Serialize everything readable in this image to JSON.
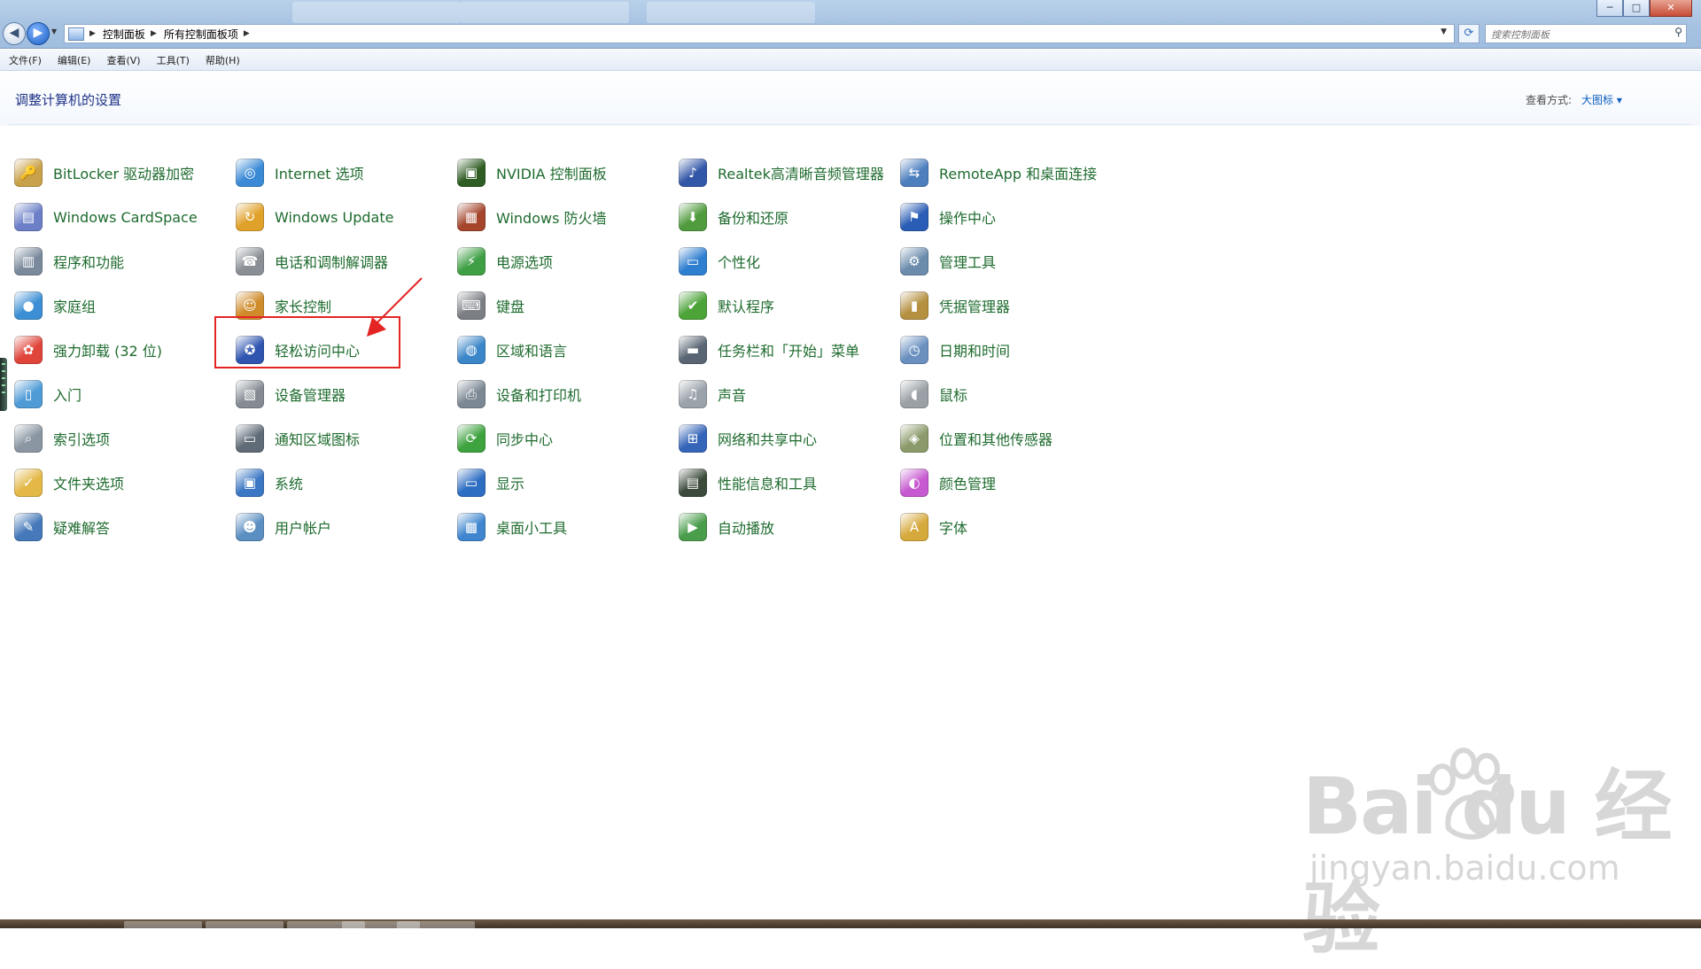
{
  "window": {
    "controls": [
      "─",
      "□",
      "✕"
    ]
  },
  "nav": {
    "back_icon": "back-arrow-icon",
    "forward_icon": "forward-arrow-icon",
    "breadcrumb": [
      "控制面板",
      "所有控制面板项"
    ],
    "search_placeholder": "搜索控制面板"
  },
  "menu": [
    "文件(F)",
    "编辑(E)",
    "查看(V)",
    "工具(T)",
    "帮助(H)"
  ],
  "header": {
    "title": "调整计算机的设置",
    "view_by_label": "查看方式:",
    "view_by_value": "大图标 ▾"
  },
  "items": [
    {
      "label": "BitLocker 驱动器加密",
      "icon": "bitlocker-icon",
      "color": "#c9a14a"
    },
    {
      "label": "Internet 选项",
      "icon": "internet-options-icon",
      "color": "#3a8ad6"
    },
    {
      "label": "NVIDIA 控制面板",
      "icon": "nvidia-icon",
      "color": "#2e5c22"
    },
    {
      "label": "Realtek高清晰音频管理器",
      "icon": "realtek-audio-icon",
      "color": "#3357a8"
    },
    {
      "label": "RemoteApp 和桌面连接",
      "icon": "remoteapp-icon",
      "color": "#4d7fbf"
    },
    {
      "label": "Windows CardSpace",
      "icon": "cardspace-icon",
      "color": "#6c7fc7"
    },
    {
      "label": "Windows Update",
      "icon": "windows-update-icon",
      "color": "#e0a12a"
    },
    {
      "label": "Windows 防火墙",
      "icon": "firewall-icon",
      "color": "#a4452c"
    },
    {
      "label": "备份和还原",
      "icon": "backup-icon",
      "color": "#4f9b3d"
    },
    {
      "label": "操作中心",
      "icon": "action-center-flag-icon",
      "color": "#2a5db5"
    },
    {
      "label": "程序和功能",
      "icon": "programs-icon",
      "color": "#7a8a9c"
    },
    {
      "label": "电话和调制解调器",
      "icon": "phone-modem-icon",
      "color": "#8a8f96"
    },
    {
      "label": "电源选项",
      "icon": "power-options-icon",
      "color": "#3f9f45"
    },
    {
      "label": "个性化",
      "icon": "personalization-icon",
      "color": "#2f7fd0"
    },
    {
      "label": "管理工具",
      "icon": "admin-tools-icon",
      "color": "#6c8cad"
    },
    {
      "label": "家庭组",
      "icon": "homegroup-icon",
      "color": "#3c8fd4"
    },
    {
      "label": "家长控制",
      "icon": "parental-controls-icon",
      "color": "#d08b2a"
    },
    {
      "label": "键盘",
      "icon": "keyboard-icon",
      "color": "#7b7f84"
    },
    {
      "label": "默认程序",
      "icon": "default-programs-icon",
      "color": "#4ca338"
    },
    {
      "label": "凭据管理器",
      "icon": "credential-manager-icon",
      "color": "#b59040"
    },
    {
      "label": "强力卸载 (32 位)",
      "icon": "uninstaller-clover-icon",
      "color": "#e0453a"
    },
    {
      "label": "轻松访问中心",
      "icon": "ease-of-access-icon",
      "color": "#2f55b0"
    },
    {
      "label": "区域和语言",
      "icon": "region-language-icon",
      "color": "#3a86c8"
    },
    {
      "label": "任务栏和「开始」菜单",
      "icon": "taskbar-start-menu-icon",
      "color": "#596573"
    },
    {
      "label": "日期和时间",
      "icon": "date-time-icon",
      "color": "#6a90c0"
    },
    {
      "label": "入门",
      "icon": "getting-started-icon",
      "color": "#4e9bd6"
    },
    {
      "label": "设备管理器",
      "icon": "device-manager-icon",
      "color": "#848b93"
    },
    {
      "label": "设备和打印机",
      "icon": "devices-printers-icon",
      "color": "#7c8894"
    },
    {
      "label": "声音",
      "icon": "sound-icon",
      "color": "#9aa2aa"
    },
    {
      "label": "鼠标",
      "icon": "mouse-icon",
      "color": "#9aa0a6"
    },
    {
      "label": "索引选项",
      "icon": "indexing-options-icon",
      "color": "#8a96a2"
    },
    {
      "label": "通知区域图标",
      "icon": "notification-area-icon",
      "color": "#5f6b77"
    },
    {
      "label": "同步中心",
      "icon": "sync-center-icon",
      "color": "#3ea33f"
    },
    {
      "label": "网络和共享中心",
      "icon": "network-sharing-icon",
      "color": "#3565b8"
    },
    {
      "label": "位置和其他传感器",
      "icon": "location-sensors-icon",
      "color": "#8b9a6a"
    },
    {
      "label": "文件夹选项",
      "icon": "folder-options-icon",
      "color": "#e4b847"
    },
    {
      "label": "系统",
      "icon": "system-icon",
      "color": "#3b77c4"
    },
    {
      "label": "显示",
      "icon": "display-icon",
      "color": "#2e6ec2"
    },
    {
      "label": "性能信息和工具",
      "icon": "performance-icon",
      "color": "#3b4a3a"
    },
    {
      "label": "颜色管理",
      "icon": "color-management-icon",
      "color": "#c75ad0"
    },
    {
      "label": "疑难解答",
      "icon": "troubleshooting-icon",
      "color": "#4579b9"
    },
    {
      "label": "用户帐户",
      "icon": "user-accounts-icon",
      "color": "#5b8fc2"
    },
    {
      "label": "桌面小工具",
      "icon": "desktop-gadgets-icon",
      "color": "#3f86cf"
    },
    {
      "label": "自动播放",
      "icon": "autoplay-icon",
      "color": "#4a9d4b"
    },
    {
      "label": "字体",
      "icon": "fonts-icon",
      "color": "#d6a93c"
    }
  ],
  "watermark": {
    "logo": "Bai du 经验",
    "url": "jingyan.baidu.com"
  },
  "colors": {
    "link_text": "#1e6b2e",
    "title_text": "#1e3287",
    "highlight": "#e42424"
  }
}
